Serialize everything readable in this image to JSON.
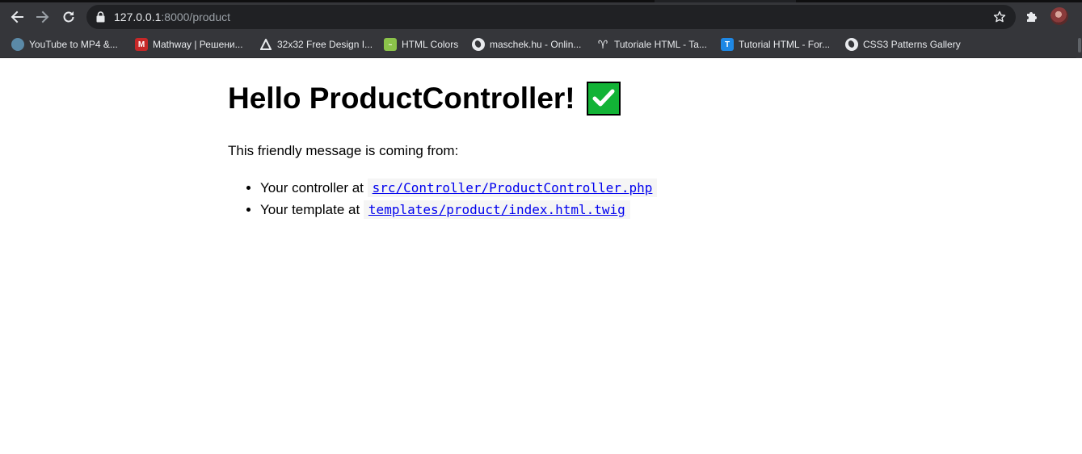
{
  "browser": {
    "url_host": "127.0.0.1",
    "url_rest": ":8000/product",
    "bookmarks": [
      {
        "label": "YouTube to MP4 &...",
        "icon": "youtube-converter-icon"
      },
      {
        "label": "Mathway | Решени...",
        "icon": "mathway-icon"
      },
      {
        "label": "32x32 Free Design I...",
        "icon": "design-icon"
      },
      {
        "label": "HTML Colors",
        "icon": "html-colors-icon"
      },
      {
        "label": "maschek.hu - Onlin...",
        "icon": "globe-icon"
      },
      {
        "label": "Tutoriale HTML - Ta...",
        "icon": "tutoriale-icon"
      },
      {
        "label": "Tutorial HTML - For...",
        "icon": "tutorial-t-icon"
      },
      {
        "label": "CSS3 Patterns Gallery",
        "icon": "globe-icon"
      }
    ]
  },
  "page": {
    "heading": "Hello ProductController!",
    "heading_emoji": "check-mark-button-icon",
    "intro": "This friendly message is coming from:",
    "items": [
      {
        "prefix": "Your controller at",
        "code": "src/Controller/ProductController.php"
      },
      {
        "prefix": "Your template at",
        "code": "templates/product/index.html.twig"
      }
    ]
  },
  "colors": {
    "chrome_toolbar": "#35363a",
    "omnibox": "#202124",
    "link": "#0000ee",
    "check_green": "#12b336"
  }
}
